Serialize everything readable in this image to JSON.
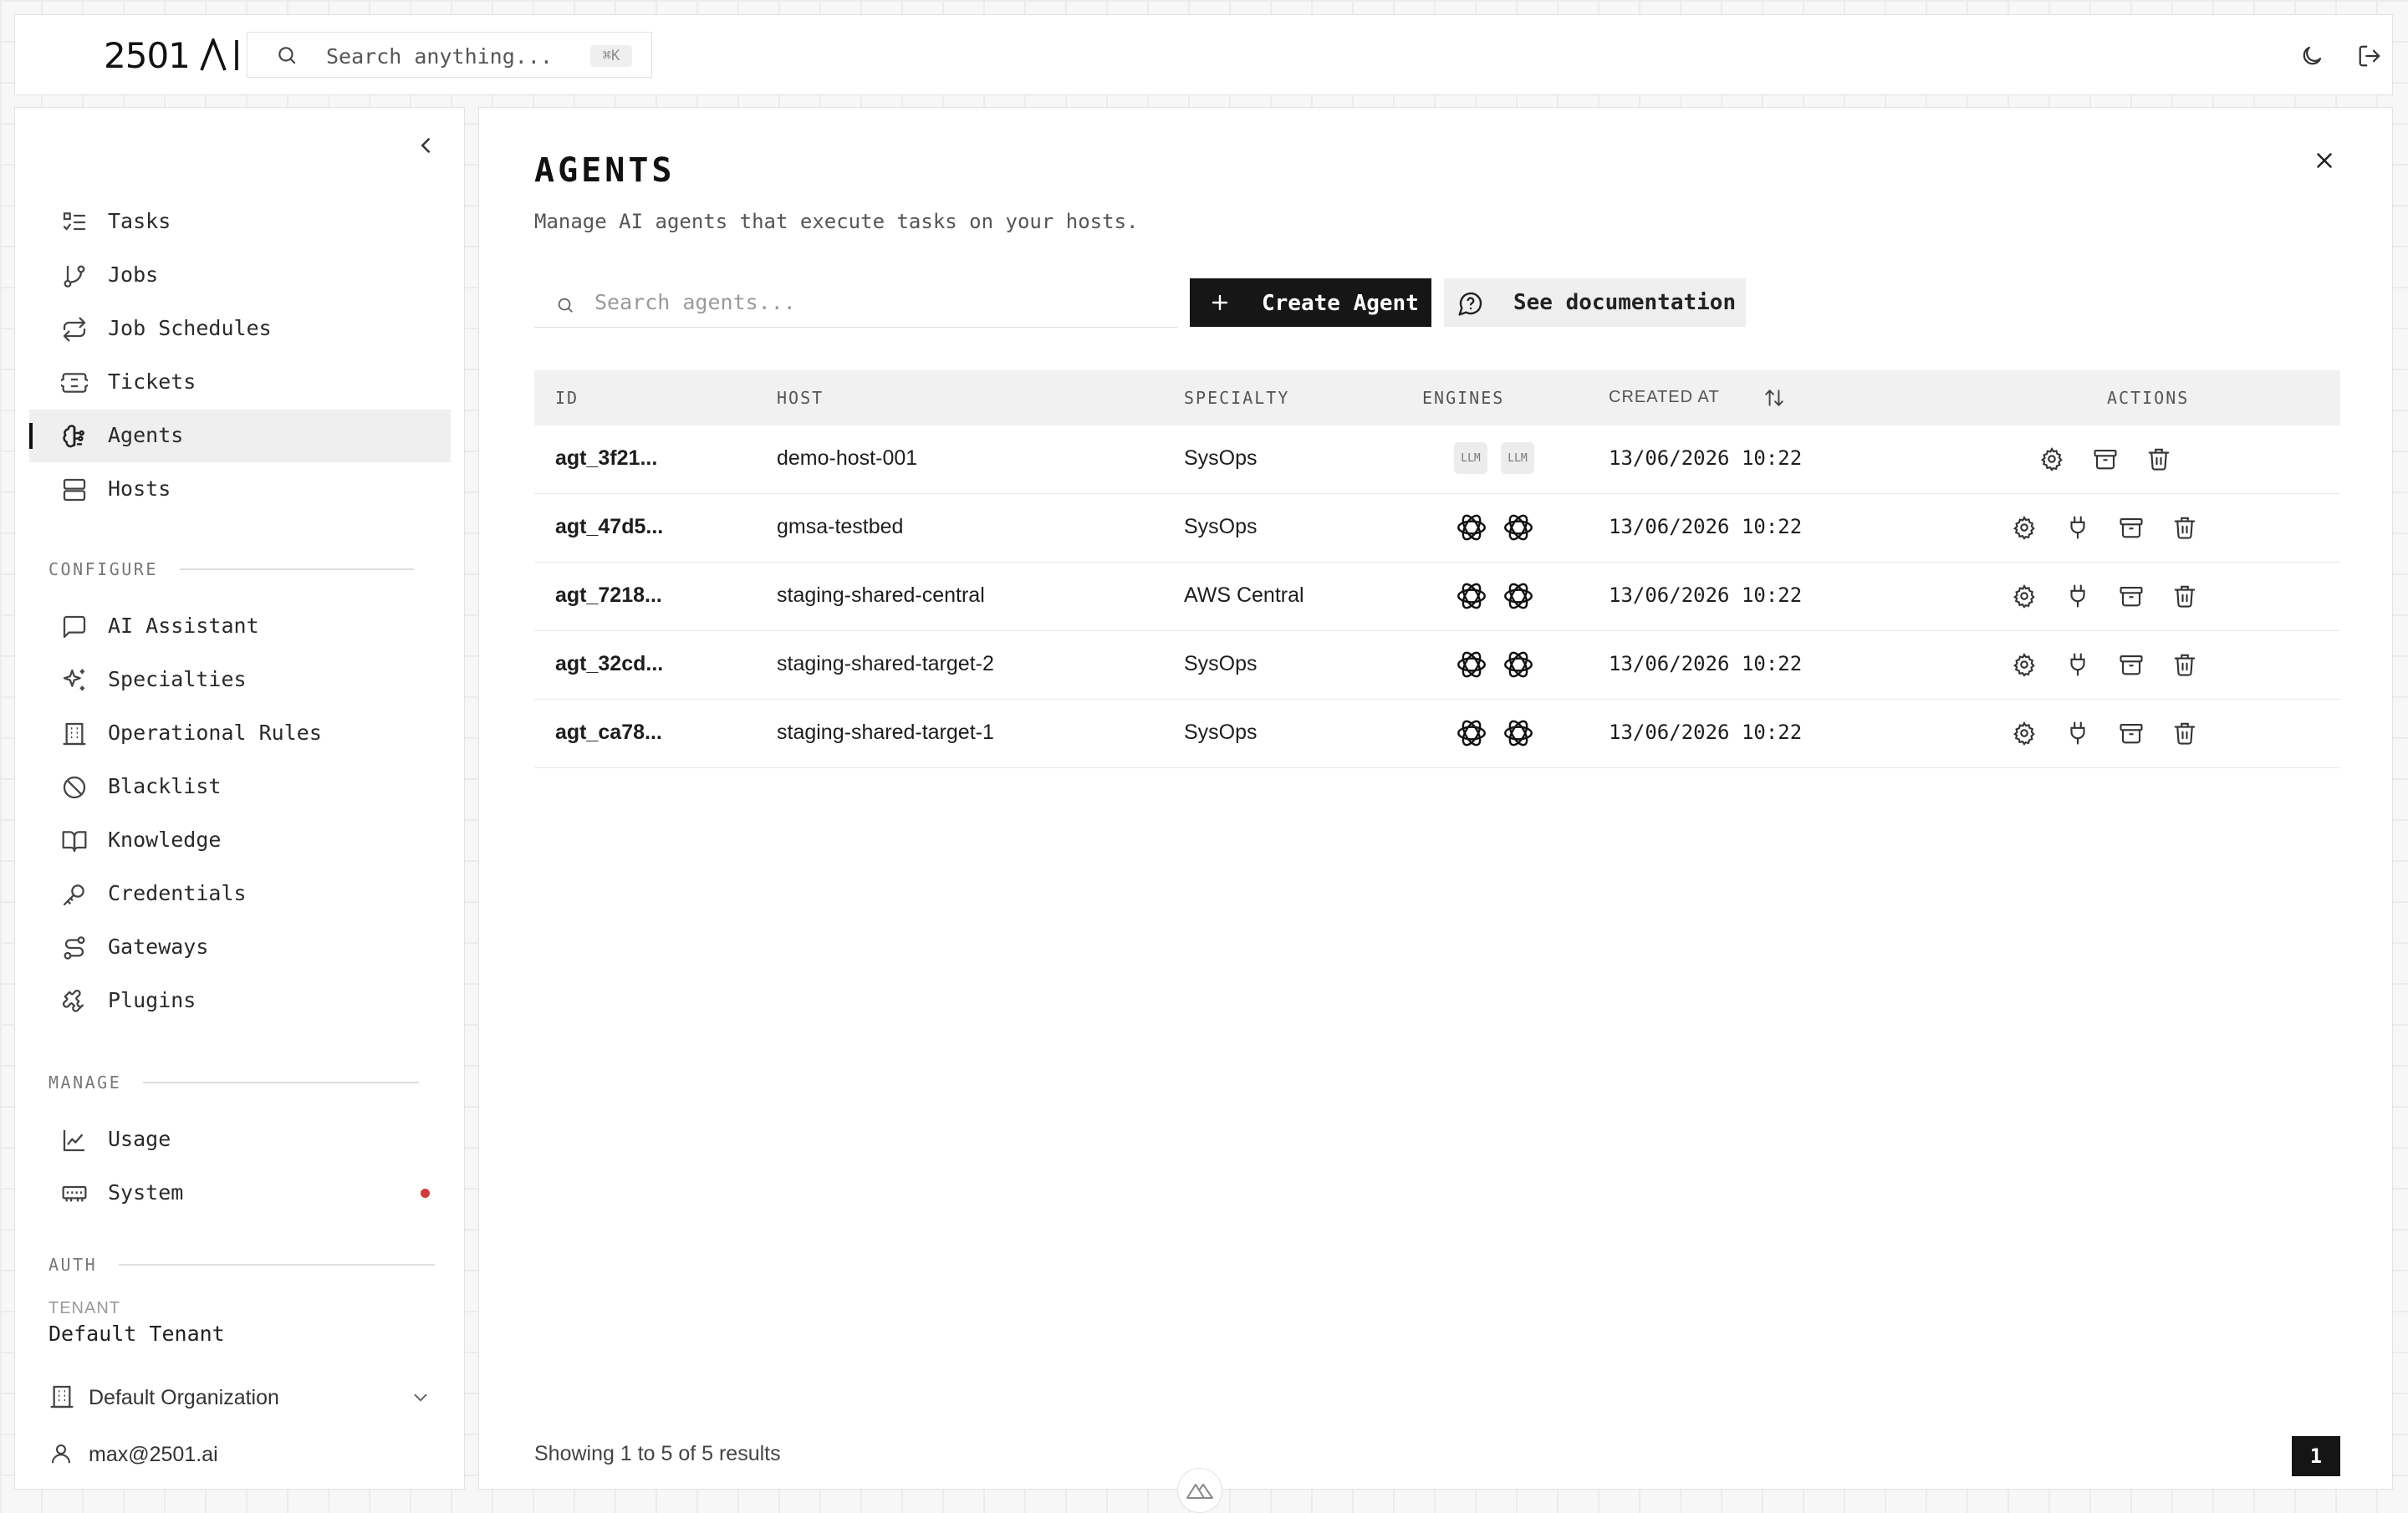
{
  "app": {
    "logo_text": "2501",
    "search_placeholder": "Search anything...",
    "search_shortcut": "⌘K"
  },
  "sidebar": {
    "nav": [
      {
        "label": "Tasks",
        "icon": "list-todo-icon"
      },
      {
        "label": "Jobs",
        "icon": "git-branch-icon"
      },
      {
        "label": "Job Schedules",
        "icon": "repeat-icon"
      },
      {
        "label": "Tickets",
        "icon": "ticket-icon"
      },
      {
        "label": "Agents",
        "icon": "brain-icon",
        "active": true
      },
      {
        "label": "Hosts",
        "icon": "server-icon"
      }
    ],
    "configure_heading": "CONFIGURE",
    "configure": [
      {
        "label": "AI Assistant",
        "icon": "message-square-icon"
      },
      {
        "label": "Specialties",
        "icon": "sparkles-icon"
      },
      {
        "label": "Operational Rules",
        "icon": "building-icon"
      },
      {
        "label": "Blacklist",
        "icon": "ban-icon"
      },
      {
        "label": "Knowledge",
        "icon": "book-open-icon"
      },
      {
        "label": "Credentials",
        "icon": "key-icon"
      },
      {
        "label": "Gateways",
        "icon": "route-icon"
      },
      {
        "label": "Plugins",
        "icon": "puzzle-icon"
      }
    ],
    "manage_heading": "MANAGE",
    "manage": [
      {
        "label": "Usage",
        "icon": "chart-line-icon"
      },
      {
        "label": "System",
        "icon": "memory-stick-icon",
        "alert": true
      }
    ],
    "auth_heading": "AUTH",
    "tenant_label": "TENANT",
    "tenant_value": "Default Tenant",
    "organization": "Default Organization",
    "user_email": "max@2501.ai"
  },
  "main": {
    "title": "AGENTS",
    "subtitle": "Manage AI agents that execute tasks on your hosts.",
    "search_placeholder": "Search agents...",
    "create_label": "Create Agent",
    "docs_label": "See documentation",
    "columns": {
      "id": "ID",
      "host": "HOST",
      "specialty": "SPECIALTY",
      "engines": "ENGINES",
      "created_at": "CREATED AT",
      "actions": "ACTIONS"
    },
    "rows": [
      {
        "id": "agt_3f21...",
        "host": "demo-host-001",
        "specialty": "SysOps",
        "engines": [
          "LLM",
          "LLM"
        ],
        "engine_type": "badge",
        "created_at": "13/06/2026 10:22",
        "actions": [
          "settings-icon",
          "archive-icon",
          "trash-icon"
        ]
      },
      {
        "id": "agt_47d5...",
        "host": "gmsa-testbed",
        "specialty": "SysOps",
        "engines": [
          "openai",
          "openai"
        ],
        "engine_type": "icon",
        "created_at": "13/06/2026 10:22",
        "actions": [
          "settings-icon",
          "plug-icon",
          "archive-icon",
          "trash-icon"
        ]
      },
      {
        "id": "agt_7218...",
        "host": "staging-shared-central",
        "specialty": "AWS Central",
        "engines": [
          "openai",
          "openai"
        ],
        "engine_type": "icon",
        "created_at": "13/06/2026 10:22",
        "actions": [
          "settings-icon",
          "plug-icon",
          "archive-icon",
          "trash-icon"
        ]
      },
      {
        "id": "agt_32cd...",
        "host": "staging-shared-target-2",
        "specialty": "SysOps",
        "engines": [
          "openai",
          "openai"
        ],
        "engine_type": "icon",
        "created_at": "13/06/2026 10:22",
        "actions": [
          "settings-icon",
          "plug-icon",
          "archive-icon",
          "trash-icon"
        ]
      },
      {
        "id": "agt_ca78...",
        "host": "staging-shared-target-1",
        "specialty": "SysOps",
        "engines": [
          "openai",
          "openai"
        ],
        "engine_type": "icon",
        "created_at": "13/06/2026 10:22",
        "actions": [
          "settings-icon",
          "plug-icon",
          "archive-icon",
          "trash-icon"
        ]
      }
    ],
    "footer_text": "Showing 1 to 5 of 5 results",
    "current_page": "1"
  },
  "colors": {
    "accent": "#161616",
    "alert_dot": "#d43a3a",
    "active_bg": "#efefef"
  }
}
